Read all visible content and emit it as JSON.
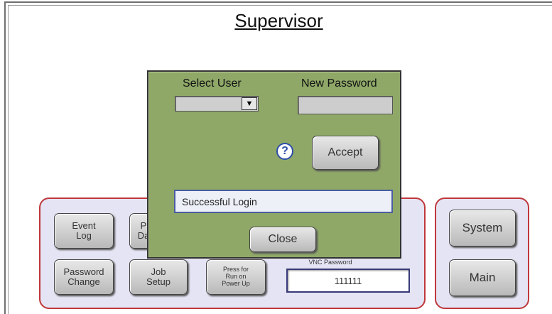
{
  "screen": {
    "title": "Supervisor"
  },
  "left_panel": {
    "buttons": {
      "event_log": "Event\nLog",
      "partial_top": "P\nDa",
      "password_change": "Password\nChange",
      "job_setup": "Job\nSetup",
      "run_on_power_up": "Press for\nRun on\nPower Up"
    },
    "vnc_password_label": "VNC Password",
    "vnc_password_value": "111111"
  },
  "right_panel": {
    "system_label": "System",
    "main_label": "Main"
  },
  "dialog": {
    "select_user_label": "Select User",
    "new_password_label": "New Password",
    "help_glyph": "?",
    "accept_label": "Accept",
    "status_text": "Successful Login",
    "close_label": "Close"
  },
  "colors": {
    "panel_border": "#c0383c",
    "panel_fill": "#e4e4f4",
    "dialog_fill": "#8fa868",
    "field_border": "#3a3a7a"
  },
  "icons": {
    "help": "help-icon",
    "dropdown": "chevron-down-icon"
  }
}
